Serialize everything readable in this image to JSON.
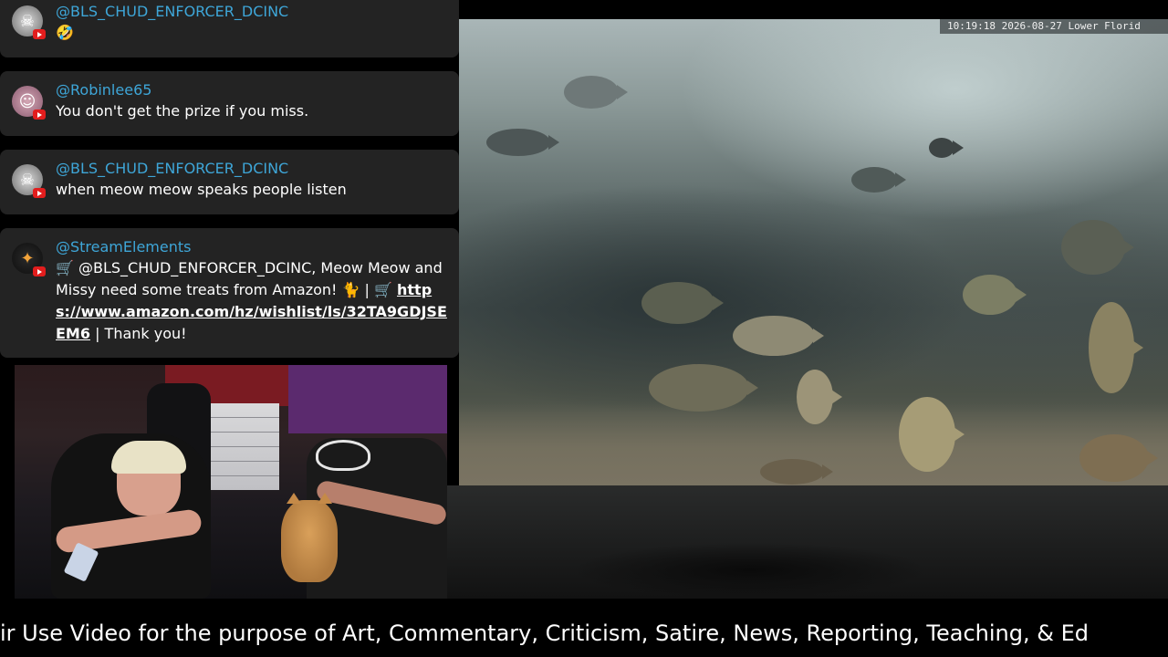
{
  "camera": {
    "timestamp": "10:19:18  2026-08-27  Lower Florid"
  },
  "chat": {
    "messages": [
      {
        "username": "@BLS_CHUD_ENFORCER_DCINC",
        "text": "🤣",
        "avatar_icon": "skull-avatar-icon"
      },
      {
        "username": "@Robinlee65",
        "text": "You don't get the prize if you miss.",
        "avatar_icon": "user-avatar-icon"
      },
      {
        "username": "@BLS_CHUD_ENFORCER_DCINC",
        "text": "when meow meow speaks people listen",
        "avatar_icon": "skull-avatar-icon"
      },
      {
        "username": "@StreamElements",
        "text_prefix": "🛒 @BLS_CHUD_ENFORCER_DCINC, Meow Meow and Missy need some treats from Amazon! 🐈 | 🛒",
        "link": "https://www.amazon.com/hz/wishlist/ls/32TA9GDJSEEM6",
        "text_suffix": " | Thank you!",
        "avatar_icon": "streamelements-avatar-icon"
      }
    ]
  },
  "ticker": {
    "text": "ir Use Video for the purpose of Art, Commentary, Criticism, Satire, News, Reporting, Teaching, & Ed"
  },
  "colors": {
    "username": "#3ea6d8",
    "chat_bg": "#232323",
    "badge": "#e21d1d"
  }
}
